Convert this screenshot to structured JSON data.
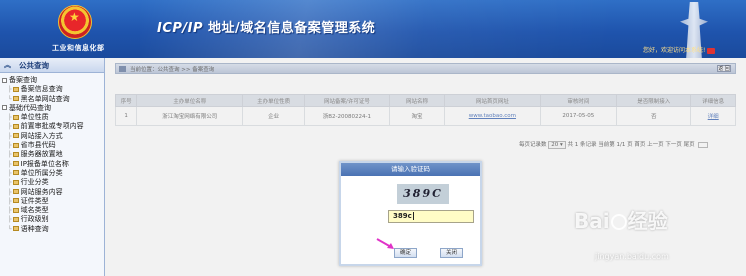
{
  "header": {
    "org_name": "工业和信息化部",
    "system_title_latin": "ICP/IP",
    "system_title_rest": " 地址/域名信息备案管理系统",
    "welcome": "您好，欢迎访问本系统!"
  },
  "sidebar": {
    "title": "公共查询",
    "groups": [
      {
        "label": "备案查询",
        "items": [
          "备案信息查询",
          "黑名单网站查询"
        ]
      },
      {
        "label": "基础代码查询",
        "items": [
          "单位性质",
          "前置审批或专项内容",
          "网站接入方式",
          "省市县代码",
          "服务器放置地",
          "IP报备单位名称",
          "单位所属分类",
          "行业分类",
          "网站服务内容",
          "证件类型",
          "域名类型",
          "行政级别",
          "语种查询"
        ]
      }
    ]
  },
  "main": {
    "breadcrumb": "当前位置：公共查询 >> 备案查询",
    "back_label": "返 回",
    "table": {
      "headers": [
        "序号",
        "主办单位名称",
        "主办单位性质",
        "网站备案/许可证号",
        "网站名称",
        "网站首页网址",
        "审核时间",
        "是否限制接入",
        "详细信息"
      ],
      "rows": [
        [
          "1",
          "浙江淘宝网络有限公司",
          "企业",
          "浙B2-20080224-1",
          "淘宝",
          "www.taobao.com",
          "2017-05-05",
          "否",
          "详细"
        ]
      ]
    },
    "pager": {
      "per_page_label": "每页记录数",
      "per_page_value": "20 ▾",
      "summary": "共 1 条记录   当前第 1/1 页 首页 上一页 下一页 尾页"
    }
  },
  "dialog": {
    "title": "请输入验证码",
    "captcha_text": "389C",
    "input_value": "389c",
    "ok_label": "确定",
    "close_label": "关闭"
  },
  "watermark": {
    "main_prefix": "Bai",
    "main_suffix": "经验",
    "sub": "jingyan.baidu.com"
  },
  "colors": {
    "header_blue": "#1f54ad",
    "input_bg": "#fffcc6",
    "arrow": "#e033c8"
  }
}
